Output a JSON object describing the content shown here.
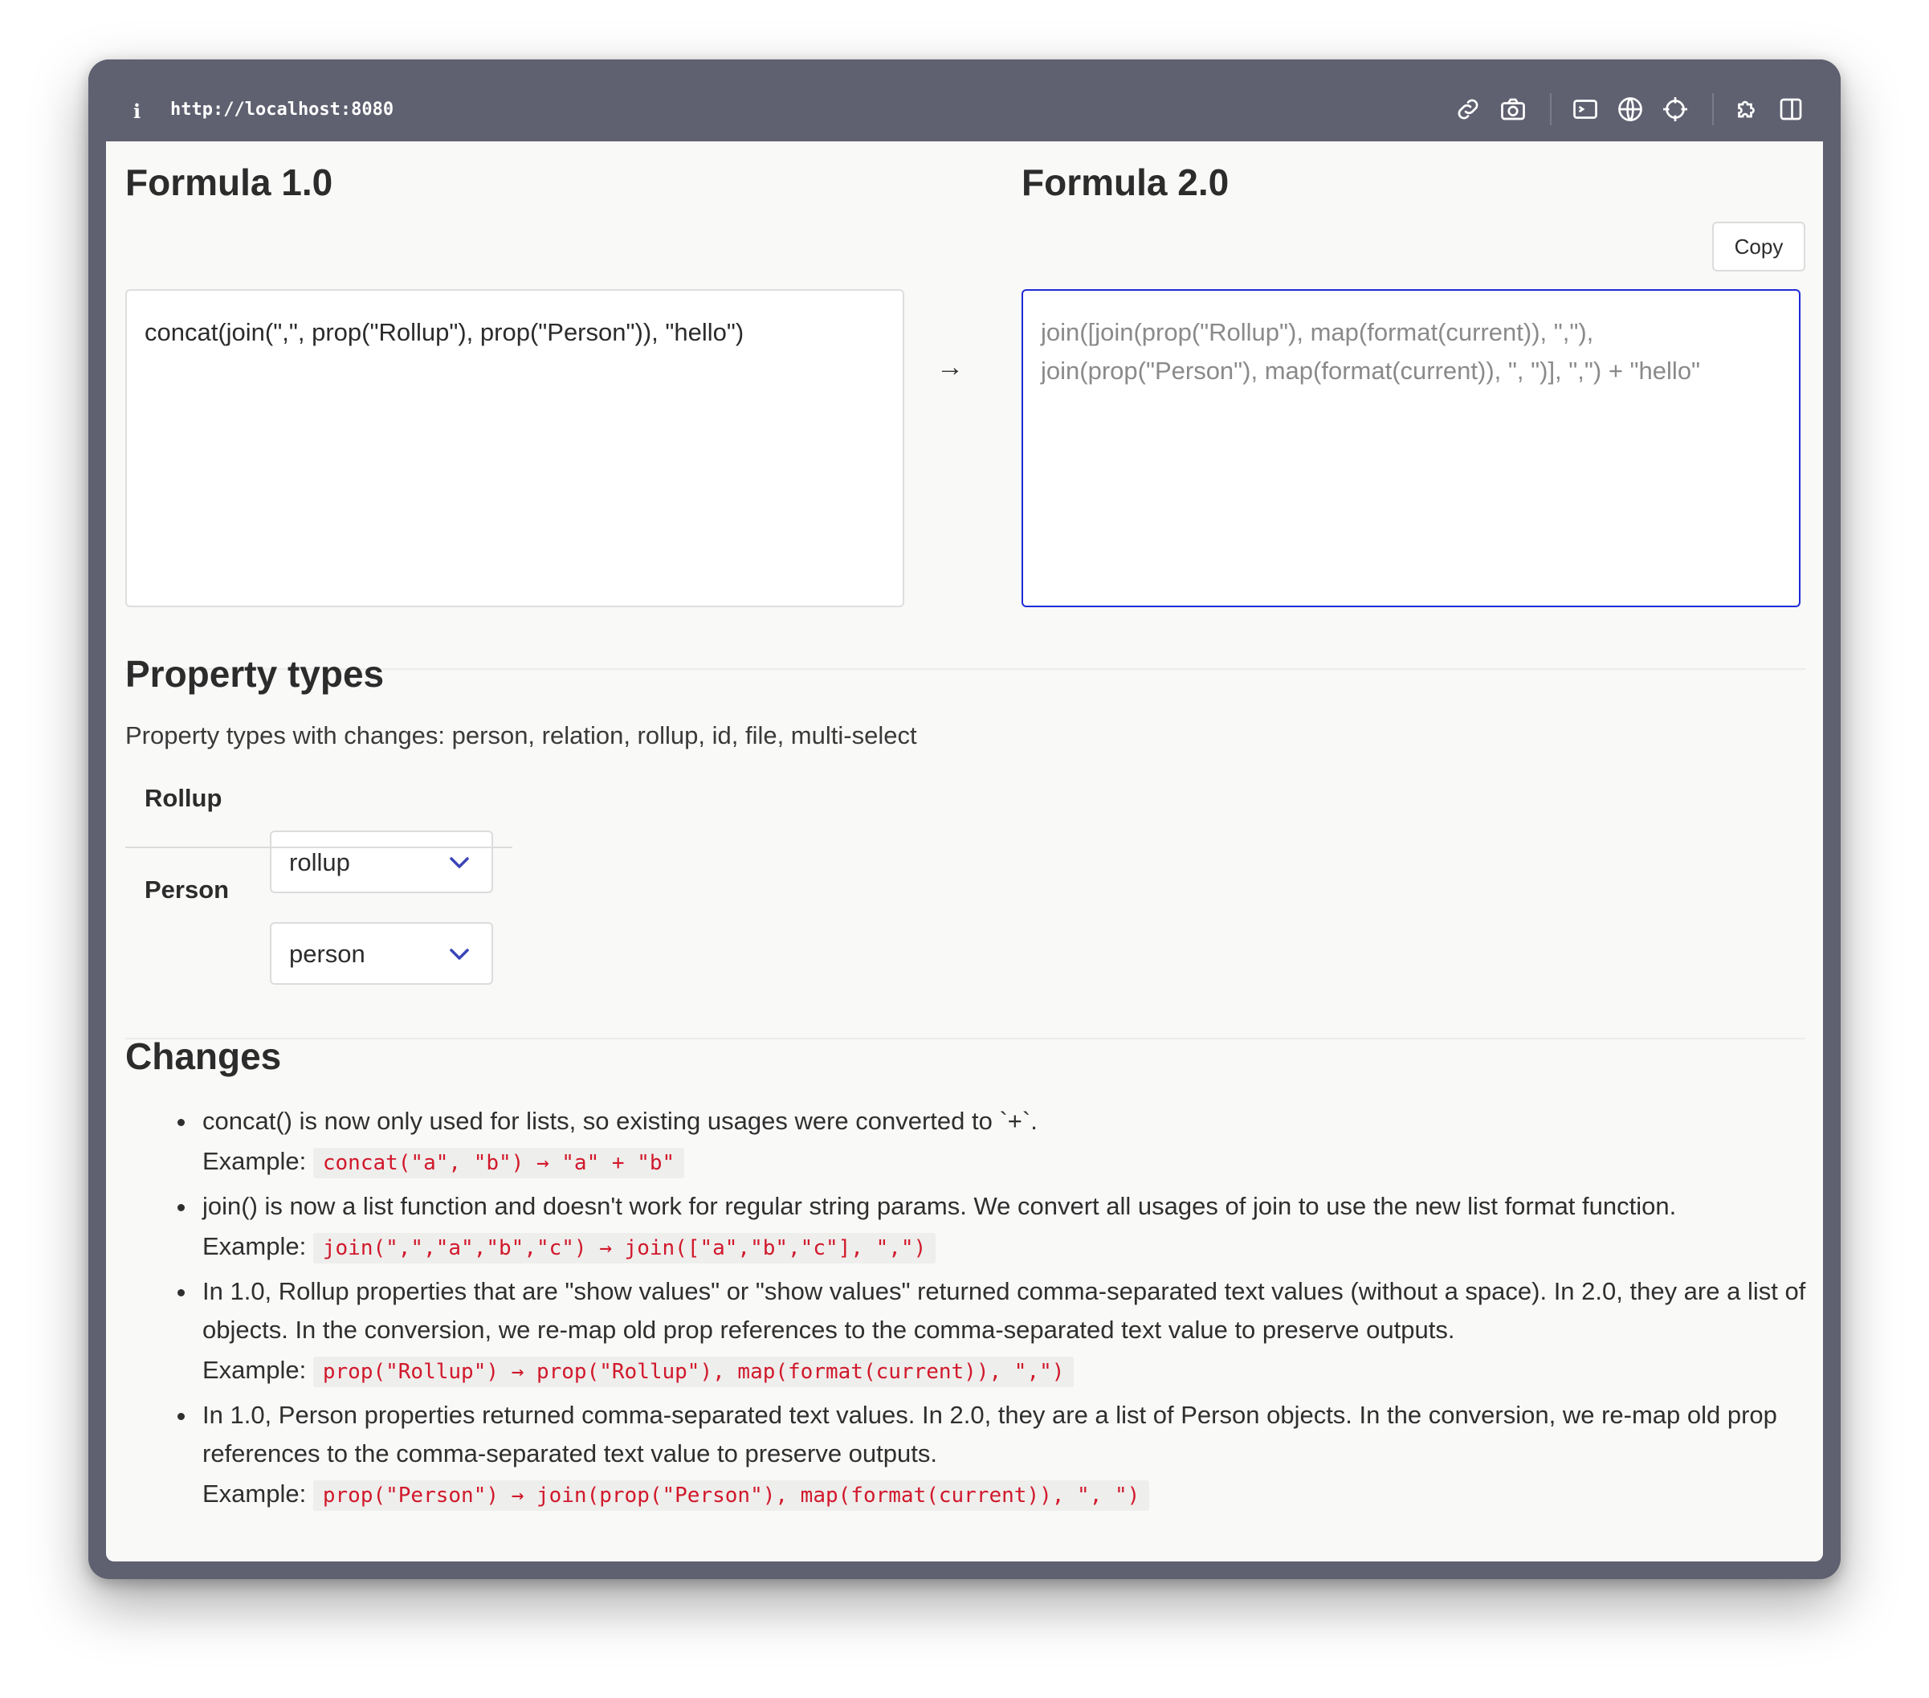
{
  "browser": {
    "url": "http://localhost:8080",
    "toolbar_icons": [
      "link-icon",
      "camera-icon",
      "terminal-icon",
      "globe-icon",
      "crosshair-icon",
      "puzzle-icon",
      "split-view-icon"
    ]
  },
  "formula1": {
    "title": "Formula 1.0",
    "value": "concat(join(\",\", prop(\"Rollup\"), prop(\"Person\")), \"hello\")"
  },
  "arrow": "→",
  "formula2": {
    "title": "Formula 2.0",
    "copy_label": "Copy",
    "value": "join([join(prop(\"Rollup\"), map(format(current)), \",\"), join(prop(\"Person\"), map(format(current)), \", \")], \",\") + \"hello\""
  },
  "property_types": {
    "title": "Property types",
    "description": "Property types with changes: person, relation, rollup, id, file, multi-select",
    "rows": [
      {
        "label": "Rollup",
        "value": "rollup"
      },
      {
        "label": "Person",
        "value": "person"
      }
    ]
  },
  "changes": {
    "title": "Changes",
    "example_label": "Example:",
    "items": [
      {
        "text": "concat() is now only used for lists, so existing usages were converted to `+`.",
        "example": "concat(\"a\", \"b\") → \"a\" + \"b\""
      },
      {
        "text": "join() is now a list function and doesn't work for regular string params. We convert all usages of join to use the new list format function.",
        "example": "join(\",\",\"a\",\"b\",\"c\") → join([\"a\",\"b\",\"c\"], \",\")"
      },
      {
        "text": "In 1.0, Rollup properties that are \"show values\" or \"show values\" returned comma-separated text values (without a space). In 2.0, they are a list of objects. In the conversion, we re-map old prop references to the comma-separated text value to preserve outputs.",
        "example": "prop(\"Rollup\") → prop(\"Rollup\"), map(format(current)), \",\")"
      },
      {
        "text": "In 1.0, Person properties returned comma-separated text values. In 2.0, they are a list of Person objects. In the conversion, we re-map old prop references to the comma-separated text value to preserve outputs.",
        "example": "prop(\"Person\") → join(prop(\"Person\"), map(format(current)), \", \")"
      }
    ]
  },
  "colors": {
    "accent_border": "#1f2ad8",
    "chevron": "#3a45b8",
    "code_text": "#d1182b",
    "titlebar": "#5f6070"
  }
}
